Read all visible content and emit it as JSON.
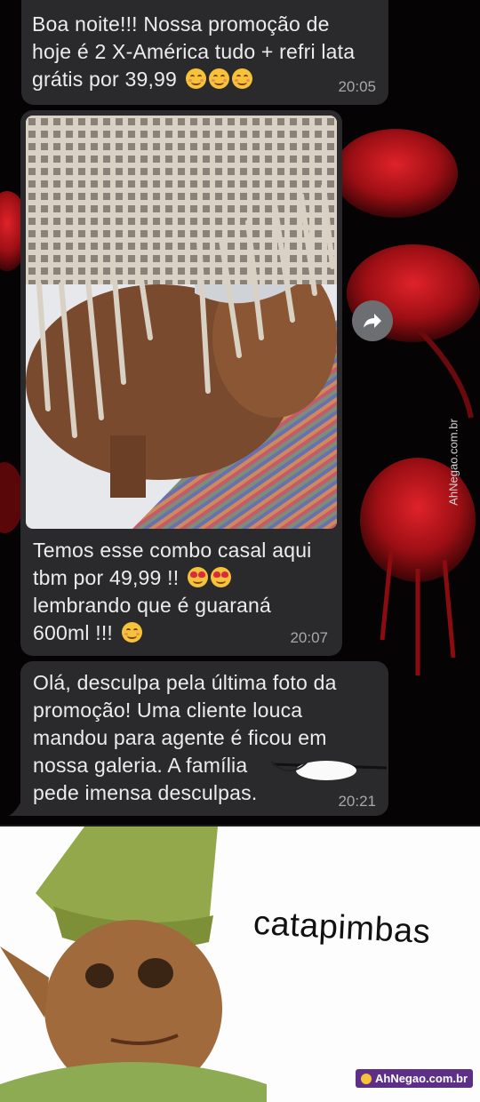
{
  "messages": [
    {
      "text_lines": [
        "Boa noite!!! Nossa promoção de",
        "hoje é 2 X-América tudo + refri lata",
        "grátis por 39,99"
      ],
      "emojis": [
        "smiling-face-icon",
        "smiling-face-icon",
        "smiling-face-icon"
      ],
      "time": "20:05"
    },
    {
      "text_lines": [
        "Temos esse combo casal aqui",
        "tbm por 49,99 !!",
        "lembrando que é guaraná",
        "600ml !!!"
      ],
      "time": "20:07"
    },
    {
      "text_lines": [
        "Olá, desculpa pela última  foto da",
        "promoção! Uma cliente louca",
        "mandou para agente é ficou em",
        "nossa galeria. A família ",
        "pede imensa desculpas."
      ],
      "time": "20:21"
    }
  ],
  "watermark_vertical": "AhNegao.com.br",
  "meme": {
    "caption": "catapimbas",
    "watermark": "AhNegao.com.br"
  },
  "colors": {
    "bubble": "#2a2a2c",
    "chat_background": "#050303",
    "forward_button": "#6d6e72",
    "watermark_badge": "#5e2f86"
  },
  "icons": [
    "forward-arrow-icon",
    "smiling-face-icon",
    "heart-eyes-icon"
  ]
}
